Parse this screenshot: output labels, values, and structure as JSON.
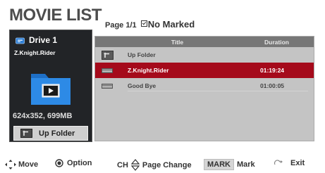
{
  "header": {
    "title": "MOVIE LIST",
    "page": "Page 1/1",
    "marked": "No Marked"
  },
  "left_panel": {
    "drive": "Drive 1",
    "file_name": "Z.Knight.Rider",
    "resolution": "624x352,",
    "size": "699MB",
    "up_folder_label": "Up Folder"
  },
  "list": {
    "col_title": "Title",
    "col_duration": "Duration",
    "rows": [
      {
        "type": "folder",
        "title": "Up Folder",
        "duration": ""
      },
      {
        "type": "video",
        "title": "Z.Knight.Rider",
        "duration": "01:19:24",
        "selected": true
      },
      {
        "type": "video",
        "title": "Good Bye",
        "duration": "01:00:05"
      }
    ]
  },
  "footer": {
    "move": "Move",
    "option": "Option",
    "ch": "CH",
    "page_change": "Page Change",
    "mark_key": "MARK",
    "mark": "Mark",
    "exit": "Exit"
  },
  "colors": {
    "selected_row": "#a50a1b",
    "list_bg": "#c4c4c4",
    "header_bar": "#777777",
    "panel_bg": "#222427",
    "folder_blue": "#1e6fc6"
  }
}
